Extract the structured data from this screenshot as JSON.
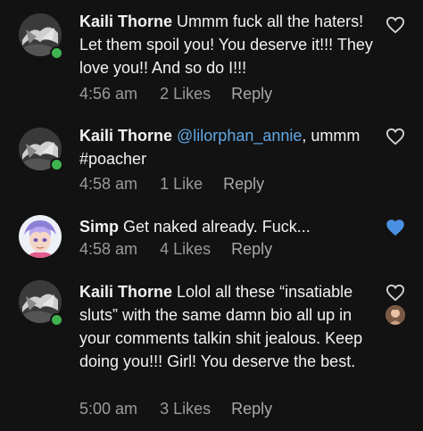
{
  "comments": [
    {
      "author": "Kaili Thorne",
      "text": "Ummm fuck all the haters! Let them spoil you! You deserve it!!! They love you!! And so do I!!!",
      "time": "4:56 am",
      "likes": "2 Likes",
      "reply": "Reply",
      "liked": false,
      "online": true,
      "avatar": "bw-avatar-icon"
    },
    {
      "author": "Kaili Thorne",
      "mention": "@lilorphan_annie",
      "text": ", ummm #poacher",
      "time": "4:58 am",
      "likes": "1 Like",
      "reply": "Reply",
      "liked": false,
      "online": true,
      "avatar": "bw-avatar-icon"
    },
    {
      "author": "Simp",
      "text": "Get naked already. Fuck...",
      "time": "4:58 am",
      "likes": "4 Likes",
      "reply": "Reply",
      "liked": true,
      "online": false,
      "avatar": "anime-avatar-icon"
    },
    {
      "author": "Kaili Thorne",
      "text": "Lolol all these “insatiable sluts” with the same damn bio all up in your comments talkin shit jealous. Keep doing you!!! Girl! You deserve the best.",
      "time": "5:00 am",
      "likes": "3 Likes",
      "reply": "Reply",
      "liked": false,
      "online": true,
      "avatar": "bw-avatar-icon",
      "liked_by_avatar": "liker-avatar-icon"
    }
  ],
  "colors": {
    "background": "#121212",
    "text": "#f2f2f2",
    "meta": "#9a9a9a",
    "mention": "#62a8e6",
    "liked_heart": "#4a90e2",
    "online": "#3fb34f"
  }
}
